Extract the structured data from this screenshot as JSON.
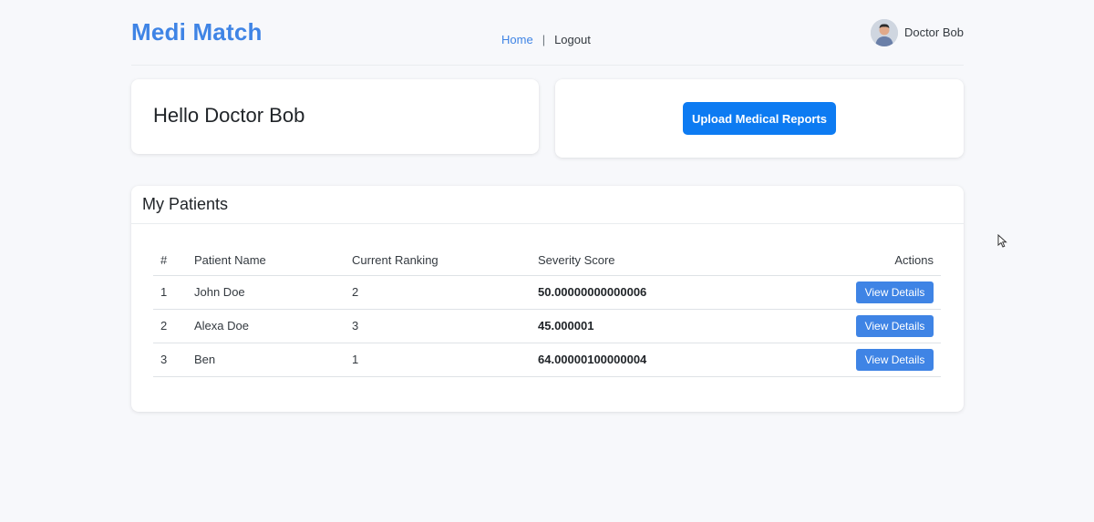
{
  "header": {
    "brand": "Medi Match",
    "nav": {
      "home": "Home",
      "separator": "|",
      "logout": "Logout"
    },
    "user_name": "Doctor Bob"
  },
  "greeting": {
    "title": "Hello Doctor Bob"
  },
  "upload": {
    "button_label": "Upload Medical Reports"
  },
  "patients": {
    "title": "My Patients",
    "columns": [
      "#",
      "Patient Name",
      "Current Ranking",
      "Severity Score",
      "Actions"
    ],
    "rows": [
      {
        "num": "1",
        "name": "John Doe",
        "ranking": "2",
        "score": "50.00000000000006",
        "action": "View Details"
      },
      {
        "num": "2",
        "name": "Alexa Doe",
        "ranking": "3",
        "score": "45.000001",
        "action": "View Details"
      },
      {
        "num": "3",
        "name": "Ben",
        "ranking": "1",
        "score": "64.00000100000004",
        "action": "View Details"
      }
    ]
  },
  "colors": {
    "brand": "#3f84e5",
    "primary_button": "#0d7bf2",
    "background": "#f7f8fb"
  },
  "icons": {
    "avatar": "user-avatar-icon",
    "cursor": "mouse-pointer-icon"
  }
}
